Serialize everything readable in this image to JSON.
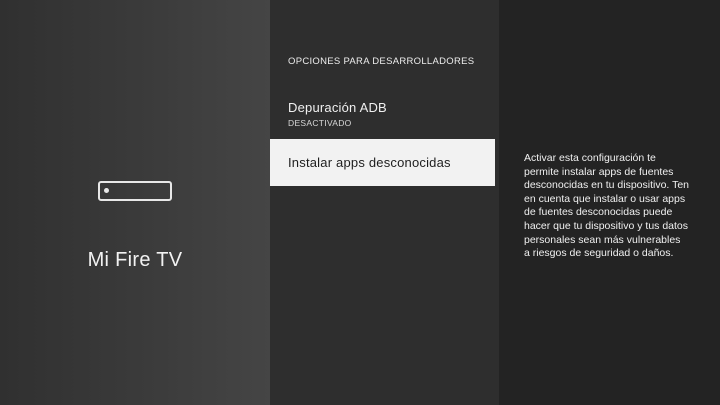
{
  "device": {
    "name": "Mi Fire TV",
    "icon": "fire-tv-device-icon"
  },
  "menu": {
    "header": "OPCIONES PARA DESARROLLADORES",
    "items": [
      {
        "label": "Depuración ADB",
        "sublabel": "DESACTIVADO"
      },
      {
        "label": "Instalar apps desconocidas"
      }
    ]
  },
  "description": "Activar esta configuración te permite instalar apps de fuentes desconocidas en tu dispositivo. Ten en cuenta que instalar o usar apps de fuentes desconocidas puede hacer que tu dispositivo y tus datos personales sean más vulnerables a riesgos de seguridad o daños.",
  "colors": {
    "selected_background": "#f2f2f2",
    "menu_background": "#2e2e2e",
    "description_background": "#232323"
  }
}
